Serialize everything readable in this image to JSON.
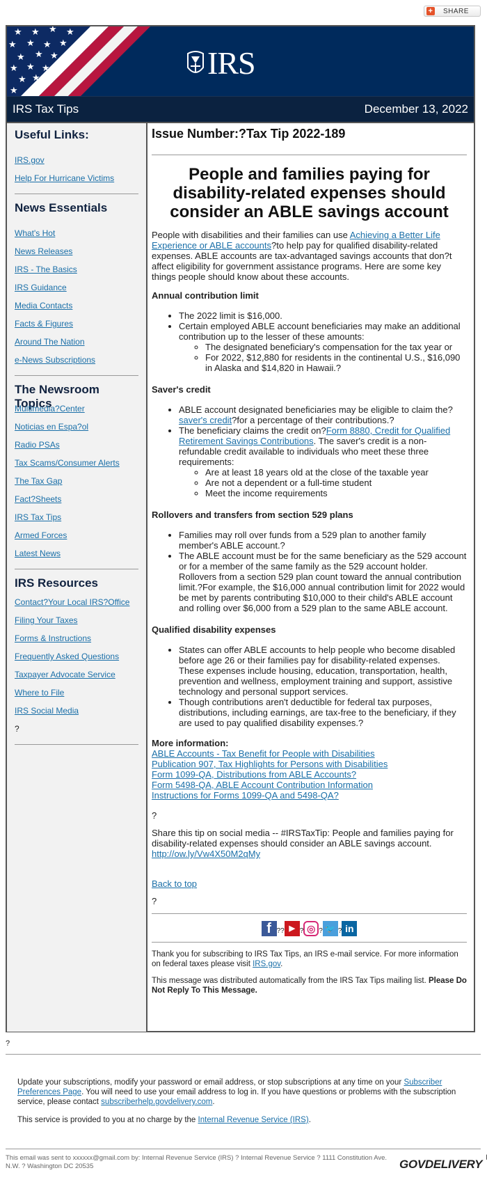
{
  "share_button": {
    "label": "SHARE",
    "icon": "plus-icon"
  },
  "banner": {
    "logo_text": "IRS",
    "logo_icon": "irs-eagle-icon"
  },
  "titlebar": {
    "title": "IRS Tax Tips",
    "date": "December 13, 2022"
  },
  "sidebar": {
    "sections": [
      {
        "title": "Useful Links:",
        "items": [
          "IRS.gov",
          "Help For Hurricane Victims"
        ]
      },
      {
        "title": "News Essentials",
        "items": [
          "What's Hot",
          "News Releases",
          "IRS - The Basics",
          "IRS Guidance",
          "Media Contacts",
          "Facts & Figures",
          "Around The Nation",
          "e-News Subscriptions"
        ]
      },
      {
        "title": "The Newsroom Topics",
        "items": [
          "Multimedia?Center",
          "Noticias en Espa?ol",
          "Radio PSAs",
          "Tax Scams/Consumer Alerts",
          "The Tax Gap",
          "Fact?Sheets",
          "IRS Tax Tips",
          "Armed Forces",
          "Latest News"
        ]
      },
      {
        "title": "IRS Resources",
        "items": [
          "Contact?Your Local IRS?Office",
          "Filing Your Taxes",
          "Forms & Instructions",
          "Frequently Asked Questions",
          "Taxpayer Advocate Service",
          "Where to File",
          "IRS Social Media"
        ],
        "trailing": "?"
      }
    ]
  },
  "main": {
    "issue": "Issue Number:?Tax Tip 2022-189",
    "headline": "People and families paying for disability-related expenses should consider an ABLE savings account",
    "intro": {
      "before": "People with disabilities and their families can use ",
      "link": "Achieving a Better Life Experience or ABLE accounts",
      "after": "?to help pay for qualified disability-related expenses. ABLE accounts are tax-advantaged savings accounts that don?t affect eligibility for government assistance programs. Here are some key things people should know about these accounts."
    },
    "annual": {
      "heading": "Annual contribution limit",
      "b1": "The 2022 limit is $16,000.",
      "b2": "Certain employed ABLE account beneficiaries may make an additional contribution up to the lesser of these amounts:",
      "b2_sub": [
        "The designated beneficiary's compensation for the tax year or",
        "For 2022, $12,880 for residents in the continental U.S., $16,090 in Alaska and $14,820 in Hawaii.?"
      ]
    },
    "savers": {
      "heading": "Saver's credit",
      "b1_before": "ABLE account designated beneficiaries may be eligible to claim the?",
      "b1_link": "saver's credit",
      "b1_after": "?for a percentage of their contributions.?",
      "b2_before": "The beneficiary claims the credit on?",
      "b2_link": "Form 8880, Credit for Qualified Retirement Savings Contributions",
      "b2_after": ". The saver's credit is a non-refundable credit available to individuals who meet these three requirements:",
      "b2_sub": [
        "Are at least 18 years old at the close of the taxable year",
        "Are not a dependent or a full-time student",
        "Meet the income requirements"
      ]
    },
    "rollovers": {
      "heading": "Rollovers and transfers from section 529 plans",
      "bullets": [
        "Families may roll over funds from a 529 plan to another family member's ABLE account.?",
        "The ABLE account must be for the same beneficiary as the 529 account or for a member of the same family as the 529 account holder. Rollovers from a section 529 plan count toward the annual contribution limit.?For example, the $16,000 annual contribution limit for 2022 would be met by parents contributing $10,000 to their child's ABLE account and rolling over $6,000 from a 529 plan to the same ABLE account."
      ]
    },
    "qualified": {
      "heading": "Qualified disability expenses",
      "bullets": [
        "States can offer ABLE accounts to help people who become disabled before age 26 or their families pay for disability-related expenses. These expenses include housing, education, transportation, health, prevention and wellness, employment training and support, assistive technology and personal support services.",
        "Though contributions aren't deductible for federal tax purposes, distributions, including earnings, are tax-free to the beneficiary, if they are used to pay qualified disability expenses.?"
      ]
    },
    "more_info": {
      "heading": "More information:",
      "links": [
        "ABLE Accounts - Tax Benefit for People with Disabilities",
        "Publication 907, Tax Highlights for Persons with Disabilities",
        "Form 1099-QA, Distributions from ABLE Accounts?",
        "Form 5498-QA, ABLE Account Contribution Information",
        "Instructions for Forms 1099-QA and 5498-QA?"
      ]
    },
    "blank1": "?",
    "share_text": "Share this tip on social media -- #IRSTaxTip: People and families paying for disability-related expenses should consider an ABLE savings account.",
    "share_link": "http://ow.ly/Vw4X50M2qMy",
    "back_to_top": "Back to top",
    "blank2": "?",
    "social": {
      "facebook": {
        "glyph": "f",
        "color": "#3b5998"
      },
      "youtube": {
        "glyph": "▶",
        "color": "#cc181e"
      },
      "instagram": {
        "glyph": "◎",
        "color": "#d62976"
      },
      "twitter": {
        "glyph": "🐦",
        "color": "#4a9fdc"
      },
      "linkedin": {
        "glyph": "in",
        "color": "#0a66a2"
      },
      "sep1": "??",
      "sep2": "?",
      "sep3": "?",
      "sep4": "?"
    },
    "thanks_before": "Thank you for subscribing to IRS Tax Tips, an IRS e-mail service. For more information on federal taxes please visit ",
    "thanks_link": "IRS.gov",
    "thanks_after": ".",
    "distributed": "This message was distributed automatically from the IRS Tax Tips mailing list. ",
    "do_not_reply": "Please Do Not Reply To This Message."
  },
  "footer": {
    "q": "?",
    "update_before": "Update your subscriptions, modify your password or email address, or stop subscriptions at any time on your ",
    "update_link": "Subscriber Preferences Page",
    "update_mid": ". You will need to use your email address to log in. If you have questions or problems with the subscription service, please contact ",
    "help_link": "subscriberhelp.govdelivery.com",
    "update_end": ".",
    "service_before": "This service is provided to you at no charge by the ",
    "service_link": "Internal Revenue Service (IRS)",
    "service_after": ".",
    "sent_text": "This email was sent to xxxxxx@gmail.com by: Internal Revenue Service (IRS) ? Internal Revenue Service ? 1111 Constitution Ave. N.W. ? Washington DC 20535",
    "brand": "GOVDELIVERY"
  }
}
